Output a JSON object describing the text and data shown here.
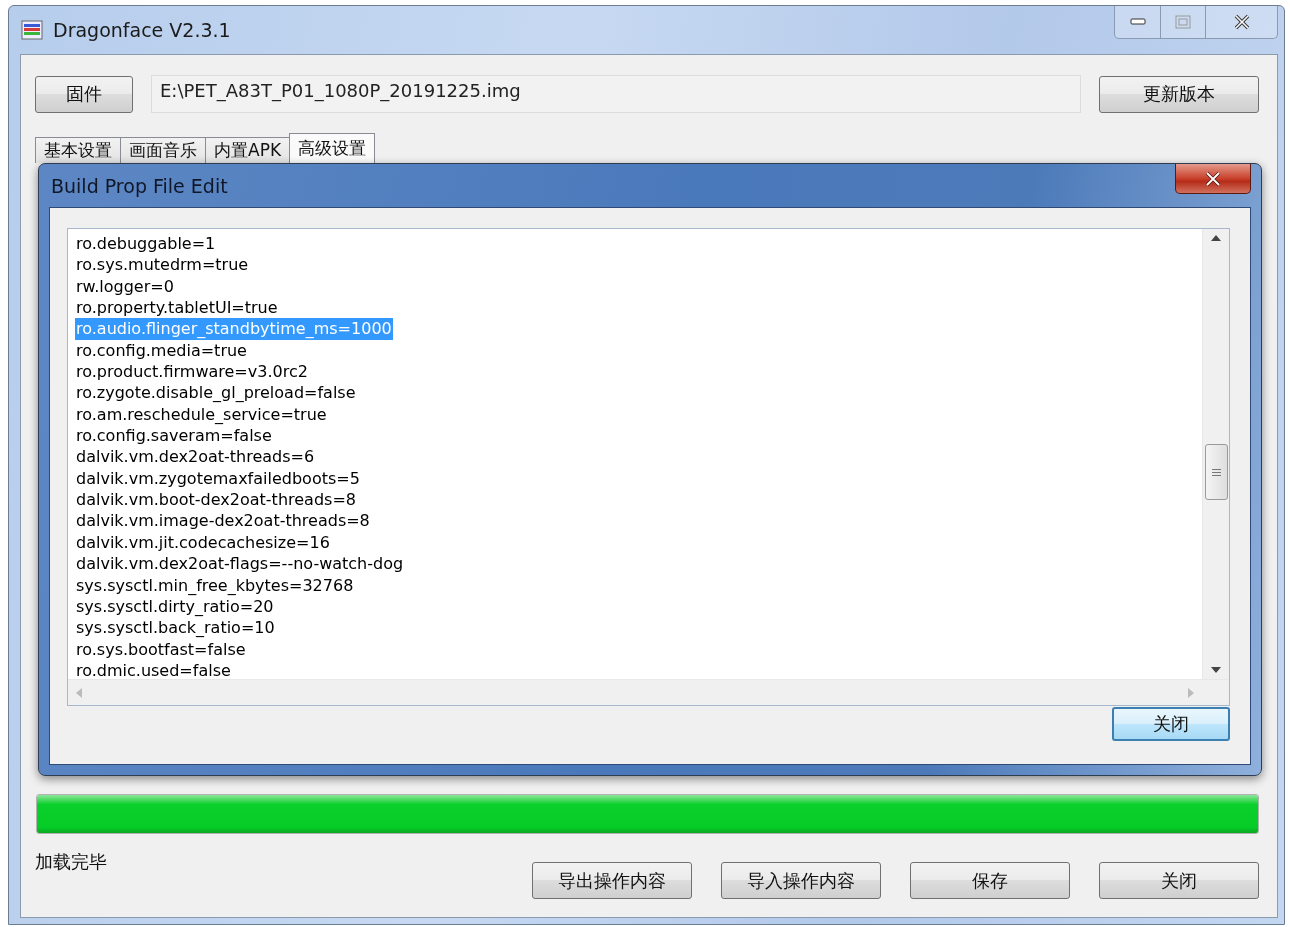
{
  "window": {
    "title": "Dragonface V2.3.1"
  },
  "firmware_button": "固件",
  "firmware_path": "E:\\PET_A83T_P01_1080P_20191225.img",
  "update_button": "更新版本",
  "tabs": [
    {
      "label": "基本设置",
      "selected": false
    },
    {
      "label": "画面音乐",
      "selected": false
    },
    {
      "label": "内置APK",
      "selected": false
    },
    {
      "label": "高级设置",
      "selected": true
    }
  ],
  "dialog": {
    "title": "Build Prop File Edit",
    "lines": [
      {
        "text": "ro.debuggable=1",
        "selected": false
      },
      {
        "text": "ro.sys.mutedrm=true",
        "selected": false
      },
      {
        "text": "rw.logger=0",
        "selected": false
      },
      {
        "text": "ro.property.tabletUI=true",
        "selected": false
      },
      {
        "text": "ro.audio.flinger_standbytime_ms=1000",
        "selected": true
      },
      {
        "text": "ro.config.media=true",
        "selected": false
      },
      {
        "text": "ro.product.firmware=v3.0rc2",
        "selected": false
      },
      {
        "text": "ro.zygote.disable_gl_preload=false",
        "selected": false
      },
      {
        "text": "ro.am.reschedule_service=true",
        "selected": false
      },
      {
        "text": "ro.config.saveram=false",
        "selected": false
      },
      {
        "text": "dalvik.vm.dex2oat-threads=6",
        "selected": false
      },
      {
        "text": "dalvik.vm.zygotemaxfailedboots=5",
        "selected": false
      },
      {
        "text": "dalvik.vm.boot-dex2oat-threads=8",
        "selected": false
      },
      {
        "text": "dalvik.vm.image-dex2oat-threads=8",
        "selected": false
      },
      {
        "text": "dalvik.vm.jit.codecachesize=16",
        "selected": false
      },
      {
        "text": "dalvik.vm.dex2oat-flags=--no-watch-dog",
        "selected": false
      },
      {
        "text": "sys.sysctl.min_free_kbytes=32768",
        "selected": false
      },
      {
        "text": "sys.sysctl.dirty_ratio=20",
        "selected": false
      },
      {
        "text": "sys.sysctl.back_ratio=10",
        "selected": false
      },
      {
        "text": "ro.sys.bootfast=false",
        "selected": false
      },
      {
        "text": "ro.dmic.used=false",
        "selected": false
      }
    ],
    "close_button": "关闭"
  },
  "progress": {
    "level": 1
  },
  "status": "加载完毕",
  "buttons": [
    "导出操作内容",
    "导入操作内容",
    "保存",
    "关闭"
  ]
}
